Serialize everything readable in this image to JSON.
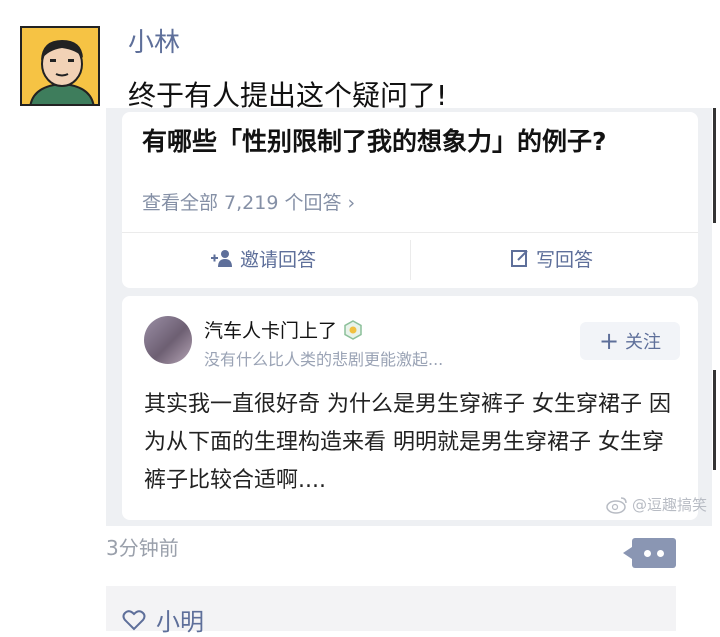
{
  "post": {
    "username": "小林",
    "text": "终于有人提出这个疑问了!",
    "time": "3分钟前"
  },
  "question_card": {
    "title": "有哪些「性别限制了我的想象力」的例子?",
    "view_all": "查看全部 7,219 个回答 ›",
    "invite_label": "邀请回答",
    "write_label": "写回答"
  },
  "answer_card": {
    "author": "汽车人卡门上了",
    "bio": "没有什么比人类的悲剧更能激起...",
    "follow_label": "关注",
    "body": "其实我一直很好奇 为什么是男生穿裤子 女生穿裙子 因为从下面的生理构造来看 明明就是男生穿裙子 女生穿裤子比较合适啊...."
  },
  "watermark": "@逗趣搞笑",
  "likes": {
    "names": "小明"
  },
  "colors": {
    "link_blue": "#5e6f9a",
    "gray_text": "#8590a6",
    "avatar_bg": "#f6c344"
  },
  "icons": [
    "user-avatar",
    "add-user-icon",
    "edit-icon",
    "verified-icon",
    "plus-icon",
    "weibo-icon",
    "comment-icon",
    "heart-icon"
  ]
}
